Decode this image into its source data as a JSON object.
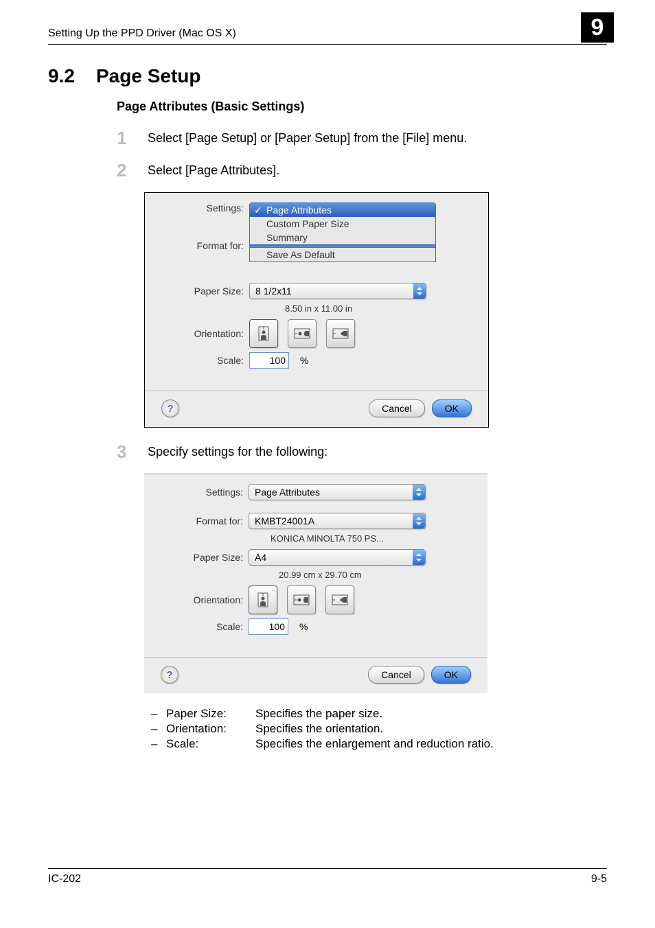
{
  "chapter_number": "9",
  "running_head": "Setting Up the PPD Driver (Mac OS X)",
  "section_number": "9.2",
  "section_title": "Page Setup",
  "subsection": "Page Attributes (Basic Settings)",
  "steps": {
    "s1": {
      "num": "1",
      "text": "Select [Page Setup] or [Paper Setup] from the [File] menu."
    },
    "s2": {
      "num": "2",
      "text": "Select [Page Attributes]."
    },
    "s3": {
      "num": "3",
      "text": "Specify settings for the following:"
    }
  },
  "dialog1": {
    "labels": {
      "settings": "Settings:",
      "format_for": "Format for:",
      "paper_size": "Paper Size:",
      "orientation": "Orientation:",
      "scale": "Scale:"
    },
    "settings_menu": {
      "item1": "Page Attributes",
      "item2": "Custom Paper Size",
      "item3": "Summary",
      "item4": "Save As Default"
    },
    "paper_size": "8 1/2x11",
    "paper_dim": "8.50 in x 11.00 in",
    "scale_value": "100",
    "percent": "%",
    "cancel": "Cancel",
    "ok": "OK"
  },
  "dialog2": {
    "labels": {
      "settings": "Settings:",
      "format_for": "Format for:",
      "paper_size": "Paper Size:",
      "orientation": "Orientation:",
      "scale": "Scale:"
    },
    "settings": "Page Attributes",
    "format_for": "KMBT24001A",
    "format_for_sub": "KONICA MINOLTA 750 PS...",
    "paper_size": "A4",
    "paper_dim": "20.99 cm x 29.70 cm",
    "scale_value": "100",
    "percent": "%",
    "cancel": "Cancel",
    "ok": "OK"
  },
  "bullets": {
    "b1": {
      "key": "Paper Size:",
      "desc": "Specifies the paper size."
    },
    "b2": {
      "key": "Orientation:",
      "desc": "Specifies the orientation."
    },
    "b3": {
      "key": "Scale:",
      "desc": "Specifies the enlargement and reduction ratio."
    }
  },
  "footer": {
    "left": "IC-202",
    "right": "9-5"
  }
}
